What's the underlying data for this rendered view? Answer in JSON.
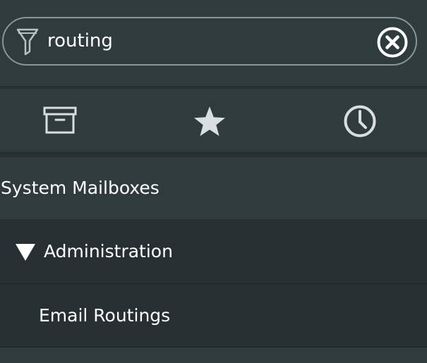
{
  "search": {
    "value": "routing",
    "filter_icon": "filter-icon",
    "clear_icon": "clear-circle-x-icon"
  },
  "tabs": [
    {
      "name": "archive",
      "icon": "archive-box-icon"
    },
    {
      "name": "favorites",
      "icon": "star-icon"
    },
    {
      "name": "recent",
      "icon": "clock-icon"
    }
  ],
  "tree": {
    "section_label": "System Mailboxes",
    "group": {
      "label": "Administration",
      "expanded": true,
      "items": [
        {
          "label": "Email Routings"
        }
      ]
    }
  },
  "colors": {
    "panel_bg": "#2f3b3d",
    "dark_bg": "#263032",
    "icon_color": "#d9dedf",
    "search_border": "#8a9597"
  }
}
